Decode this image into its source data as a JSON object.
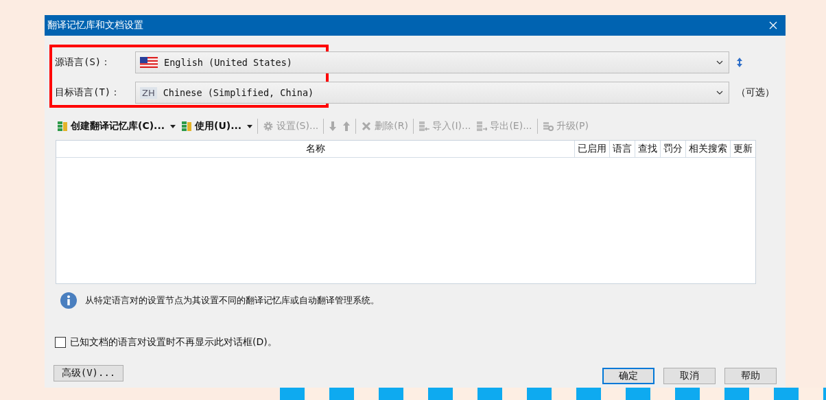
{
  "window": {
    "title": "翻译记忆库和文档设置"
  },
  "languages": [
    {
      "label": "源语言(S)：",
      "value": "English (United States)",
      "kind": "flag"
    },
    {
      "label": "目标语言(T)：",
      "value": "Chinese (Simplified, China)",
      "kind": "code",
      "code": "ZH",
      "note": "（可选）"
    }
  ],
  "toolbar": [
    {
      "kind": "menu",
      "label": "创建翻译记忆库(C)...",
      "disabled": false,
      "bold": true
    },
    {
      "kind": "menu",
      "label": "使用(U)...",
      "disabled": false,
      "bold": true
    },
    {
      "kind": "separator"
    },
    {
      "kind": "button",
      "label": "设置(S)...",
      "disabled": true
    },
    {
      "kind": "separator"
    },
    {
      "kind": "down",
      "disabled": true
    },
    {
      "kind": "up",
      "disabled": true
    },
    {
      "kind": "separator"
    },
    {
      "kind": "button",
      "label": "删除(R)",
      "disabled": true
    },
    {
      "kind": "separator"
    },
    {
      "kind": "button",
      "label": "导入(I)...",
      "disabled": true
    },
    {
      "kind": "button",
      "label": "导出(E)...",
      "disabled": true
    },
    {
      "kind": "separator"
    },
    {
      "kind": "button",
      "label": "升级(P)",
      "disabled": true
    }
  ],
  "table": {
    "columns": [
      "名称",
      "已启用",
      "语言",
      "查找",
      "罚分",
      "相关搜索",
      "更新"
    ]
  },
  "info": "从特定语言对的设置节点为其设置不同的翻译记忆库或自动翻译管理系统。",
  "checkbox": {
    "label": "已知文档的语言对设置时不再显示此对话框(D)。",
    "checked": false
  },
  "advanced_button": "高级(V)...",
  "buttons": [
    {
      "label": "确定",
      "default": true
    },
    {
      "label": "取消",
      "default": false
    },
    {
      "label": "帮助",
      "default": false
    }
  ]
}
